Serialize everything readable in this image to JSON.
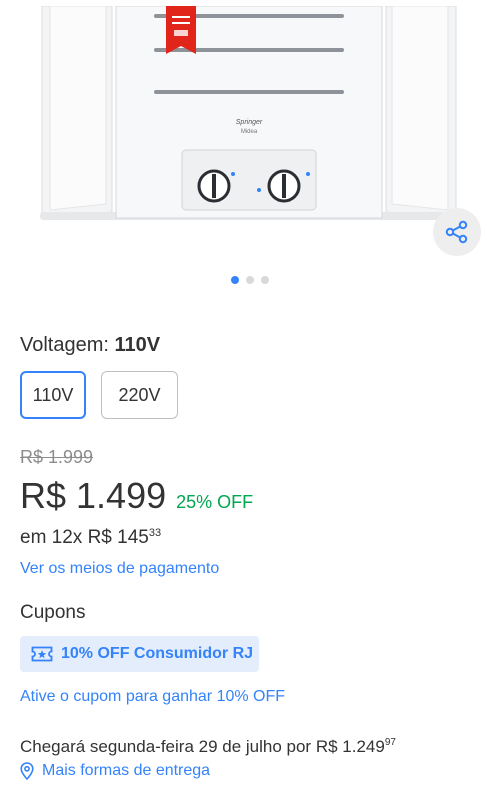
{
  "colors": {
    "accent": "#3483fa",
    "discount": "#00a650",
    "header_yellow": "#fff159",
    "coupon_bg": "#e3edfb"
  },
  "gallery": {
    "badge_brand": "Springer",
    "badge_sub": "Midea",
    "share_icon": "share-icon",
    "dots_count": 3,
    "active_dot": 0
  },
  "voltage": {
    "label": "Voltagem:",
    "selected_value": "110V",
    "options": [
      "110V",
      "220V"
    ]
  },
  "price": {
    "old": "R$ 1.999",
    "current": "R$ 1.499",
    "discount": "25% OFF",
    "installments_prefix": "em 12x R$ 145",
    "installments_cents": "33",
    "payment_link": "Ver os meios de pagamento"
  },
  "coupons": {
    "title": "Cupons",
    "chip_label": "10% OFF Consumidor RJ",
    "chip_icon": "ticket-star-icon",
    "activate_link": "Ative o cupom para ganhar 10% OFF"
  },
  "delivery": {
    "text": "Chegará segunda-feira 29 de julho por R$ 1.249",
    "cents": "97",
    "more_link": "Mais formas de entrega",
    "more_icon": "location-pin-icon"
  }
}
